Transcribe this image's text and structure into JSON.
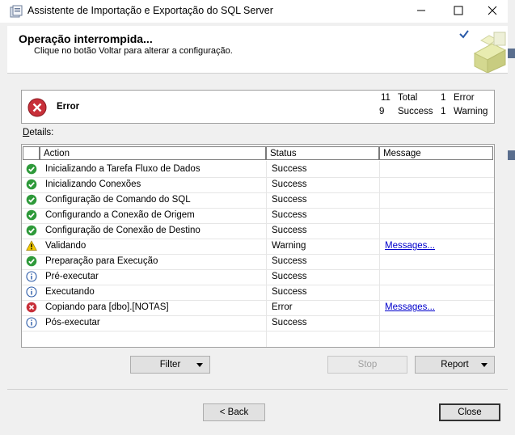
{
  "window": {
    "title": "Assistente de Importação e Exportação do SQL Server"
  },
  "header": {
    "title": "Operação interrompida...",
    "subtitle": "Clique no botão Voltar para alterar a configuração."
  },
  "summary": {
    "label": "Error",
    "total_count": "11",
    "total_label": "Total",
    "error_count": "1",
    "error_label": "Error",
    "success_count": "9",
    "success_label": "Success",
    "warning_count": "1",
    "warning_label": "Warning"
  },
  "details": {
    "label_prefix": "D",
    "label_rest": "etails:",
    "columns": {
      "action": "Action",
      "status": "Status",
      "message": "Message"
    },
    "rows": [
      {
        "icon": "success-icon",
        "action": "Inicializando a Tarefa Fluxo de Dados",
        "status": "Success",
        "message": ""
      },
      {
        "icon": "success-icon",
        "action": "Inicializando Conexões",
        "status": "Success",
        "message": ""
      },
      {
        "icon": "success-icon",
        "action": "Configuração de Comando do SQL",
        "status": "Success",
        "message": ""
      },
      {
        "icon": "success-icon",
        "action": "Configurando a Conexão de Origem",
        "status": "Success",
        "message": ""
      },
      {
        "icon": "success-icon",
        "action": "Configuração de Conexão de Destino",
        "status": "Success",
        "message": ""
      },
      {
        "icon": "warning-icon",
        "action": "Validando",
        "status": "Warning",
        "message": "Messages..."
      },
      {
        "icon": "success-icon",
        "action": "Preparação para Execução",
        "status": "Success",
        "message": ""
      },
      {
        "icon": "info-icon",
        "action": "Pré-executar",
        "status": "Success",
        "message": ""
      },
      {
        "icon": "info-icon",
        "action": "Executando",
        "status": "Success",
        "message": ""
      },
      {
        "icon": "error-icon",
        "action": "Copiando para [dbo].[NOTAS]",
        "status": "Error",
        "message": "Messages..."
      },
      {
        "icon": "info-icon",
        "action": "Pós-executar",
        "status": "Success",
        "message": ""
      }
    ]
  },
  "buttons": {
    "filter": "Filter",
    "stop": "Stop",
    "report": "Report",
    "back": "< Back",
    "close": "Close"
  },
  "colors": {
    "success": "#2e9a3a",
    "warning": "#f2c800",
    "info": "#2a5aa8",
    "error": "#c8303a",
    "link": "#0000cc"
  }
}
